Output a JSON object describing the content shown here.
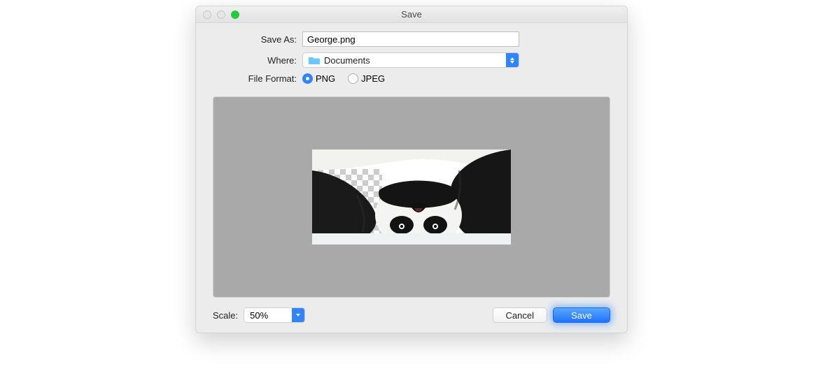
{
  "window": {
    "title": "Save"
  },
  "form": {
    "save_as_label": "Save As:",
    "save_as_value": "George.png",
    "where_label": "Where:",
    "where_value": "Documents",
    "format_label": "File Format:",
    "format_options": {
      "png": "PNG",
      "jpeg": "JPEG"
    },
    "selected_format": "PNG"
  },
  "bottom": {
    "scale_label": "Scale:",
    "scale_value": "50%",
    "cancel_label": "Cancel",
    "save_label": "Save"
  },
  "preview": {
    "subject": "upside-down panda on transparent/checkered background"
  }
}
